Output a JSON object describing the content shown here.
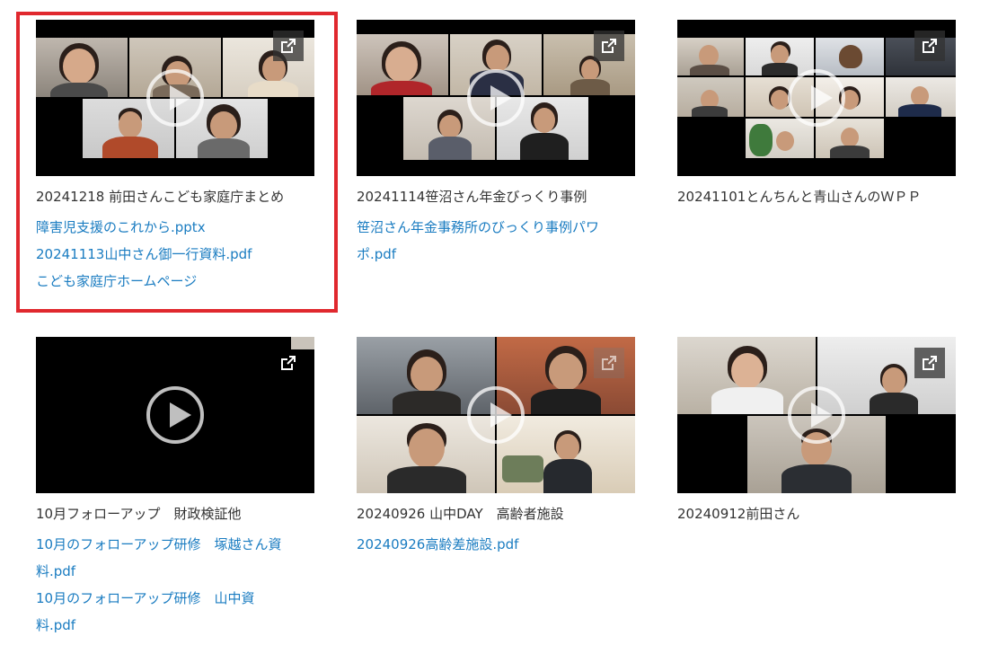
{
  "colors": {
    "link": "#1a7cc1",
    "text": "#333333",
    "highlight": "#e0282e"
  },
  "videos": [
    {
      "caption": "20241218 前田さんこども家庭庁まとめ",
      "links": [
        "障害児支援のこれから.pptx",
        "20241113山中さん御一行資料.pdf",
        "こども家庭庁ホームページ"
      ]
    },
    {
      "caption": "20241114笹沼さん年金びっくり事例",
      "links": [
        "笹沼さん年金事務所のびっくり事例パワポ.pdf"
      ]
    },
    {
      "caption": "20241101とんちんと青山さんのＷＰＰ",
      "links": []
    },
    {
      "caption": "10月フォローアップ　財政検証他",
      "links": [
        "10月のフォローアップ研修　塚越さん資料.pdf",
        "10月のフォローアップ研修　山中資料.pdf"
      ]
    },
    {
      "caption": "20240926 山中DAY　高齢者施設",
      "links": [
        "20240926高齢差施設.pdf"
      ]
    },
    {
      "caption": "20240912前田さん",
      "links": []
    }
  ],
  "icons": {
    "play": "play-circle-icon",
    "external": "external-link-icon"
  }
}
